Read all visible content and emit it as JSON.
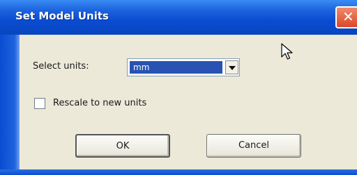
{
  "window": {
    "title": "Set Model Units",
    "close_glyph": "✕"
  },
  "select_units": {
    "label": "Select units:",
    "value": "mm"
  },
  "rescale": {
    "label": "Rescale to new units",
    "checked": false
  },
  "buttons": {
    "ok": "OK",
    "cancel": "Cancel"
  },
  "icons": {
    "close": "close-icon",
    "dropdown": "chevron-down-icon",
    "cursor": "mouse-pointer-icon"
  },
  "colors": {
    "titlebar": "#0a4cd1",
    "selection": "#2853b3",
    "close_button": "#d9482a",
    "dialog_bg": "#ece9d8"
  }
}
